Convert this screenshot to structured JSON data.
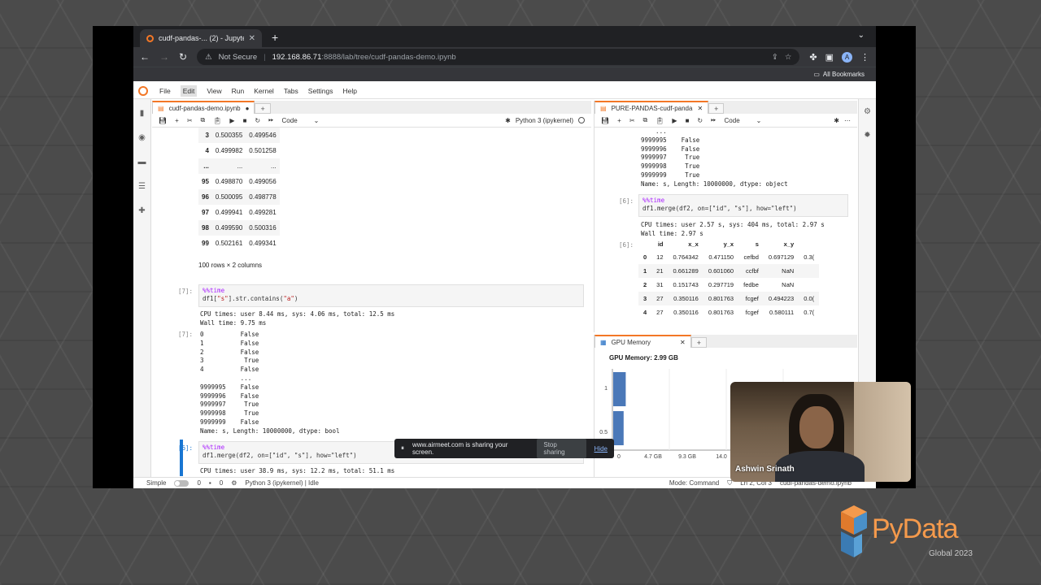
{
  "browser": {
    "tab_title": "cudf-pandas-... (2) - Jupyter...",
    "tab_close": "✕",
    "new_tab": "+",
    "not_secure": "Not Secure",
    "url_host": "192.168.86.71",
    "url_path": ":8888/lab/tree/cudf-pandas-demo.ipynb",
    "bookmarks": "All Bookmarks",
    "avatar_letter": "A"
  },
  "menu": [
    "File",
    "Edit",
    "View",
    "Run",
    "Kernel",
    "Tabs",
    "Settings",
    "Help"
  ],
  "left_notebook": {
    "tab_title": "cudf-pandas-demo.ipynb",
    "cell_type": "Code",
    "kernel": "Python 3 (ipykernel)",
    "table_rows": [
      {
        "idx": "3",
        "a": "0.500355",
        "b": "0.499546"
      },
      {
        "idx": "4",
        "a": "0.499982",
        "b": "0.501258"
      },
      {
        "idx": "...",
        "a": "...",
        "b": "..."
      },
      {
        "idx": "95",
        "a": "0.498870",
        "b": "0.499056"
      },
      {
        "idx": "96",
        "a": "0.500095",
        "b": "0.498778"
      },
      {
        "idx": "97",
        "a": "0.499941",
        "b": "0.499281"
      },
      {
        "idx": "98",
        "a": "0.499590",
        "b": "0.500316"
      },
      {
        "idx": "99",
        "a": "0.502161",
        "b": "0.499341"
      }
    ],
    "rows_cols": "100 rows × 2 columns",
    "cell7_prompt_in": "[7]:",
    "cell7_line1": "%%time",
    "cell7_line2_pre": "df1[",
    "cell7_line2_str1": "\"s\"",
    "cell7_line2_mid": "].str.contains(",
    "cell7_line2_str2": "\"a\"",
    "cell7_line2_end": ")",
    "cell7_times": "CPU times: user 8.44 ms, sys: 4.06 ms, total: 12.5 ms\nWall time: 9.75 ms",
    "cell7_prompt_out": "[7]:",
    "cell7_output": "0          False\n1          False\n2          False\n3           True\n4          False\n           ...\n9999995    False\n9999996    False\n9999997     True\n9999998     True\n9999999    False\nName: s, Length: 10000000, dtype: bool",
    "cell6_prompt": "[6]:",
    "cell6_line1": "%%time",
    "cell6_line2": "df1.merge(df2, on=[\"id\", \"s\"], how=\"left\")",
    "cell6_times": "CPU times: user 38.9 ms, sys: 12.2 ms, total: 51.1 ms"
  },
  "right_notebook": {
    "tab_title": "PURE-PANDAS-cudf-panda",
    "cell_type": "Code",
    "output_top": "    ...\n9999995    False\n9999996    False\n9999997     True\n9999998     True\n9999999     True\nName: s, Length: 10000000, dtype: object",
    "cell6_prompt": "[6]:",
    "cell6_line1": "%%time",
    "cell6_line2": "df1.merge(df2, on=[\"id\", \"s\"], how=\"left\")",
    "cell6_times": "CPU times: user 2.57 s, sys: 404 ms, total: 2.97 s\nWall time: 2.97 s",
    "cell6_prompt_out": "[6]:",
    "columns": [
      "",
      "id",
      "x_x",
      "y_x",
      "s",
      "x_y"
    ],
    "rows": [
      [
        "0",
        "12",
        "0.764342",
        "0.471150",
        "cefbd",
        "0.697129",
        "0.3("
      ],
      [
        "1",
        "21",
        "0.661289",
        "0.601060",
        "ccfbf",
        "NaN",
        ""
      ],
      [
        "2",
        "31",
        "0.151743",
        "0.297719",
        "fedbe",
        "NaN",
        ""
      ],
      [
        "3",
        "27",
        "0.350116",
        "0.801763",
        "fcgef",
        "0.494223",
        "0.0("
      ],
      [
        "4",
        "27",
        "0.350116",
        "0.801763",
        "fcgef",
        "0.580111",
        "0.7("
      ]
    ]
  },
  "gpu_panel": {
    "tab_title": "GPU Memory",
    "chart_title": "GPU Memory: 2.99 GB",
    "y_ticks": [
      "1",
      "0.5",
      "0"
    ],
    "x_ticks": [
      "0",
      "4.7 GB",
      "9.3 GB",
      "14.0"
    ]
  },
  "chart_data": {
    "type": "bar",
    "title": "GPU Memory: 2.99 GB",
    "categories": [
      "",
      ""
    ],
    "values": [
      1.35,
      0.7
    ],
    "xlim": [
      0,
      14.0
    ],
    "note_ticks": [
      "0",
      "4.7 GB",
      "9.3 GB",
      "14.0"
    ]
  },
  "status": {
    "mode_simple": "Simple",
    "count1": "0",
    "count2": "0",
    "kernel": "Python 3 (ipykernel) | Idle",
    "mode": "Mode: Command",
    "position": "Ln 2, Col 3",
    "file": "cudf-pandas-demo.ipynb"
  },
  "share_banner": {
    "text": "www.airmeet.com is sharing your screen.",
    "stop": "Stop sharing",
    "hide": "Hide"
  },
  "webcam": {
    "name": "Ashwin Srinath"
  },
  "logo": {
    "word": "PyData",
    "sub": "Global 2023"
  }
}
